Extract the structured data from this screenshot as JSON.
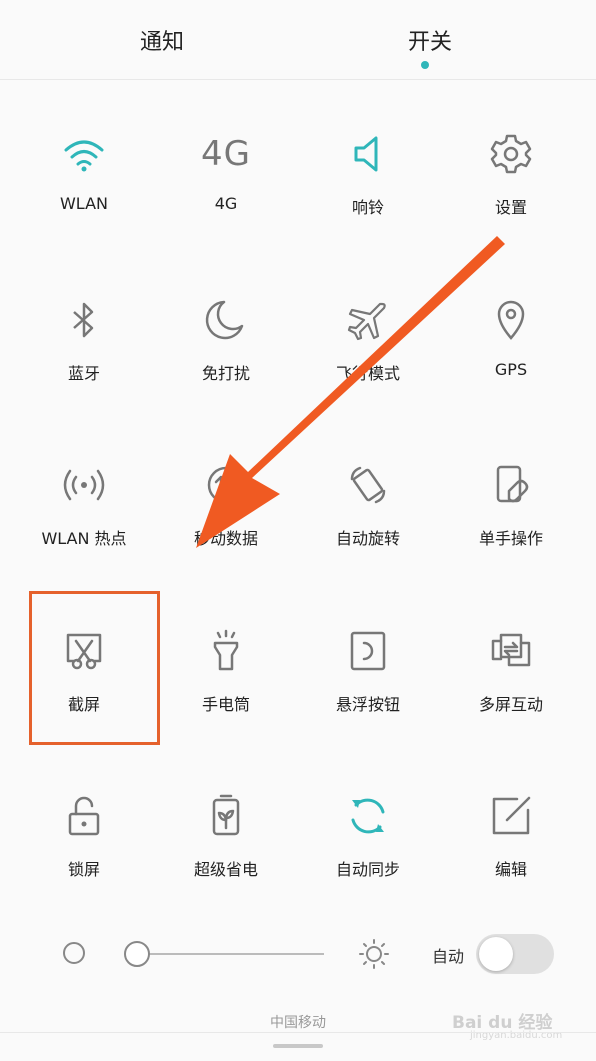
{
  "tabs": [
    {
      "label": "通知",
      "active": false
    },
    {
      "label": "开关",
      "active": true
    }
  ],
  "accent_color": "#2fb6b9",
  "highlight_color": "#e5612c",
  "toggles": [
    {
      "label": "WLAN",
      "icon": "wifi-icon",
      "active": true
    },
    {
      "label": "4G",
      "icon": "4g-icon",
      "icon_text": "4G",
      "active": false
    },
    {
      "label": "响铃",
      "icon": "speaker-icon",
      "active": true
    },
    {
      "label": "设置",
      "icon": "gear-icon",
      "active": false
    },
    {
      "label": "蓝牙",
      "icon": "bluetooth-icon",
      "active": false
    },
    {
      "label": "免打扰",
      "icon": "moon-icon",
      "active": false
    },
    {
      "label": "飞行模式",
      "icon": "airplane-icon",
      "active": false
    },
    {
      "label": "GPS",
      "icon": "location-pin-icon",
      "active": false
    },
    {
      "label": "WLAN 热点",
      "icon": "hotspot-icon",
      "active": false
    },
    {
      "label": "移动数据",
      "icon": "mobile-data-icon",
      "active": false
    },
    {
      "label": "自动旋转",
      "icon": "auto-rotate-icon",
      "active": false
    },
    {
      "label": "单手操作",
      "icon": "one-hand-icon",
      "active": false
    },
    {
      "label": "截屏",
      "icon": "screenshot-scissors-icon",
      "active": false,
      "highlighted": true
    },
    {
      "label": "手电筒",
      "icon": "flashlight-icon",
      "active": false
    },
    {
      "label": "悬浮按钮",
      "icon": "floating-button-icon",
      "active": false
    },
    {
      "label": "多屏互动",
      "icon": "multi-screen-icon",
      "active": false
    },
    {
      "label": "锁屏",
      "icon": "padlock-icon",
      "active": false
    },
    {
      "label": "超级省电",
      "icon": "battery-saver-icon",
      "active": false
    },
    {
      "label": "自动同步",
      "icon": "sync-icon",
      "active": true
    },
    {
      "label": "编辑",
      "icon": "edit-icon",
      "active": false
    }
  ],
  "brightness": {
    "level": 0.0,
    "auto_label": "自动",
    "auto_enabled": false
  },
  "carrier": "中国移动",
  "watermark": {
    "text": "Bai du 经验",
    "sub": "jingyan.baidu.com"
  }
}
